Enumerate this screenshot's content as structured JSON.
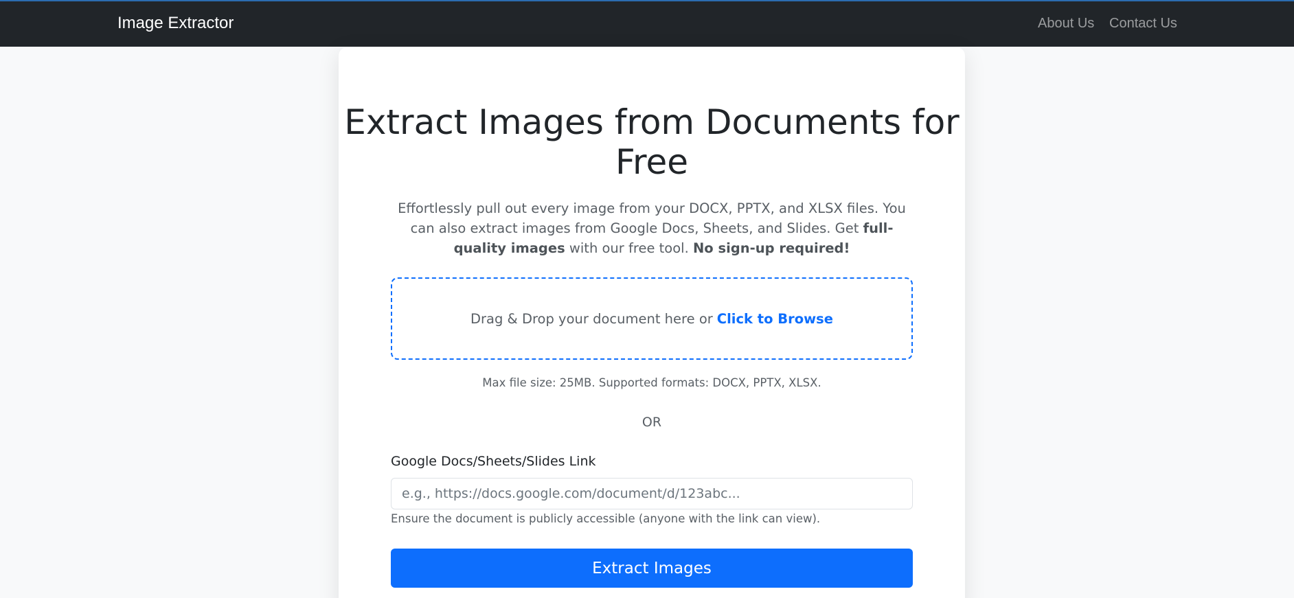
{
  "navbar": {
    "brand": "Image Extractor",
    "links": [
      "About Us",
      "Contact Us"
    ]
  },
  "hero": {
    "title": "Extract Images from Documents for Free",
    "lead_part1": "Effortlessly pull out every image from your DOCX, PPTX, and XLSX files. You can also extract images from Google Docs, Sheets, and Slides. Get ",
    "lead_bold1": "full-quality images",
    "lead_part2": " with our free tool. ",
    "lead_bold2": "No sign-up required!"
  },
  "upload": {
    "drop_text": "Drag & Drop your document here or",
    "browse_label": "Click to Browse",
    "hint": "Max file size: 25MB. Supported formats: DOCX, PPTX, XLSX."
  },
  "divider": "OR",
  "link_form": {
    "label": "Google Docs/Sheets/Slides Link",
    "placeholder": "e.g., https://docs.google.com/document/d/123abc...",
    "value": "",
    "help": "Ensure the document is publicly accessible (anyone with the link can view)."
  },
  "actions": {
    "extract_label": "Extract Images"
  },
  "colors": {
    "accent": "#0d6efd",
    "navbar": "#212529",
    "background": "#f8f9fa"
  }
}
